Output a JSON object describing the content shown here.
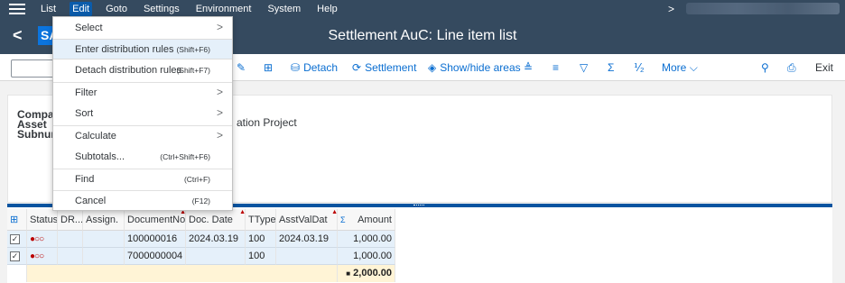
{
  "menubar": {
    "items": [
      "List",
      "Edit",
      "Goto",
      "Settings",
      "Environment",
      "System",
      "Help"
    ],
    "overflow": ">"
  },
  "titlebar": {
    "back": "<",
    "logo": "SAP",
    "title": "Settlement AuC: Line item list"
  },
  "toolbar": {
    "detach": "Detach",
    "settlement": "Settlement",
    "show_hide": "Show/hide areas",
    "sigma": "Σ",
    "subtotal": "⅟₂",
    "more": "More",
    "exit": "Exit"
  },
  "header": {
    "labels": [
      "Compar",
      "Asset",
      "Subnum"
    ],
    "asset_desc_partial": "ation Project"
  },
  "dropdown": {
    "items": [
      {
        "label": "Select",
        "shortcut": "",
        "submenu": true
      },
      {
        "label": "Enter distribution rules",
        "shortcut": "(Shift+F6)",
        "submenu": false
      },
      {
        "label": "Detach distribution rules",
        "shortcut": "(Shift+F7)",
        "submenu": false
      },
      {
        "label": "Filter",
        "shortcut": "",
        "submenu": true
      },
      {
        "label": "Sort",
        "shortcut": "",
        "submenu": true
      },
      {
        "label": "Calculate",
        "shortcut": "",
        "submenu": true
      },
      {
        "label": "Subtotals...",
        "shortcut": "(Ctrl+Shift+F6)",
        "submenu": false
      },
      {
        "label": "Find",
        "shortcut": "(Ctrl+F)",
        "submenu": false
      },
      {
        "label": "Cancel",
        "shortcut": "(F12)",
        "submenu": false
      }
    ],
    "arrow": ">"
  },
  "grid": {
    "columns": [
      "Status",
      "DR...",
      "Assign.",
      "DocumentNo",
      "Doc. Date",
      "TType",
      "AsstValDat",
      "Σ",
      "Amount"
    ],
    "rows": [
      {
        "checked": "✓",
        "status": "●○○",
        "dr": "",
        "assign": "",
        "docno": "100000016",
        "docdate": "2024.03.19",
        "ttype": "100",
        "asstval": "2024.03.19",
        "amount": "1,000.00"
      },
      {
        "checked": "✓",
        "status": "●○○",
        "dr": "",
        "assign": "",
        "docno": "7000000004",
        "docdate": "",
        "ttype": "100",
        "asstval": "",
        "amount": "1,000.00"
      }
    ],
    "total": "2,000.00",
    "total_marker": "■"
  },
  "colors": {
    "shell": "#354a5f",
    "accent": "#0a6ed1",
    "alert_red": "#bb0000",
    "selected_row": "#e5f0fa",
    "total_row": "#fff4d6"
  }
}
